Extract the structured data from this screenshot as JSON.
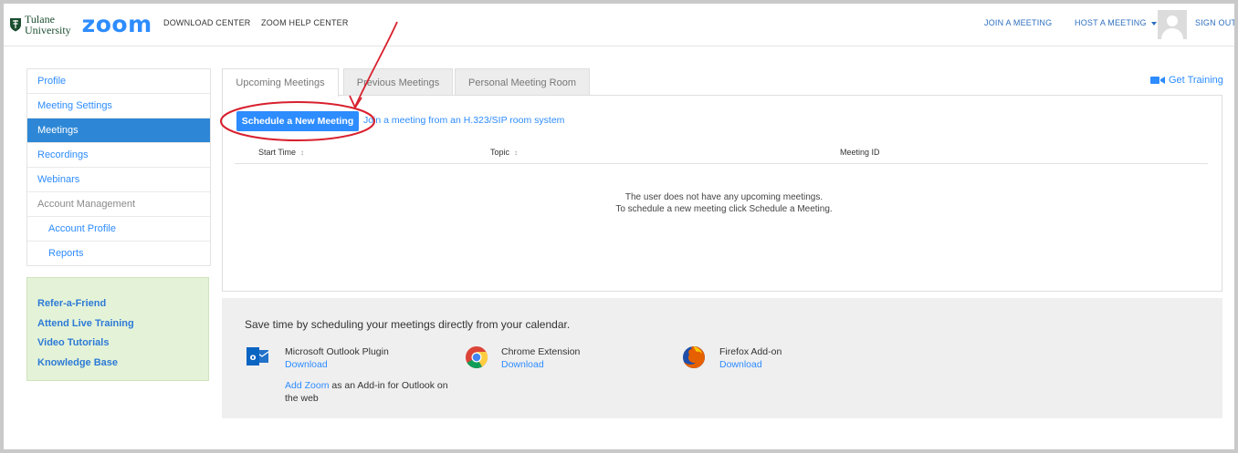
{
  "header": {
    "logo_university": "Tulane\nUniversity",
    "logo_line1": "Tulane",
    "logo_line2": "University",
    "logo_app": "zoom",
    "nav_download": "DOWNLOAD CENTER",
    "nav_help": "ZOOM HELP CENTER",
    "join": "JOIN A MEETING",
    "host": "HOST A MEETING",
    "signout": "SIGN OUT"
  },
  "sidebar": {
    "items": [
      {
        "label": "Profile"
      },
      {
        "label": "Meeting Settings"
      },
      {
        "label": "Meetings"
      },
      {
        "label": "Recordings"
      },
      {
        "label": "Webinars"
      },
      {
        "label": "Account Management"
      },
      {
        "label": "Account Profile"
      },
      {
        "label": "Reports"
      }
    ]
  },
  "help": {
    "refer": "Refer-a-Friend",
    "live": "Attend Live Training",
    "videos": "Video Tutorials",
    "kb": "Knowledge Base"
  },
  "tabs": [
    {
      "label": "Upcoming Meetings"
    },
    {
      "label": "Previous Meetings"
    },
    {
      "label": "Personal Meeting Room"
    }
  ],
  "get_training": "Get Training",
  "schedule_button": "Schedule a New Meeting",
  "join_sip": "Join a meeting from an H.323/SIP room system",
  "table": {
    "columns": [
      "Start Time",
      "Topic",
      "Meeting ID"
    ],
    "sort_glyph": "↕"
  },
  "empty_message": {
    "line1": "The user does not have any upcoming meetings.",
    "line2": "To schedule a new meeting click Schedule a Meeting."
  },
  "calendar": {
    "title": "Save time by scheduling your meetings directly from your calendar.",
    "outlook_name": "Microsoft Outlook Plugin",
    "outlook_dl": "Download",
    "outlook_addin_link": "Add Zoom",
    "outlook_addin_rest": " as an Add-in for Outlook on the web",
    "chrome_name": "Chrome Extension",
    "chrome_dl": "Download",
    "firefox_name": "Firefox Add-on",
    "firefox_dl": "Download"
  },
  "colors": {
    "accent": "#2d8cff",
    "sidebar_active": "#2e87d6",
    "annotation": "#d8202e",
    "help_bg": "#e4f3d8"
  }
}
